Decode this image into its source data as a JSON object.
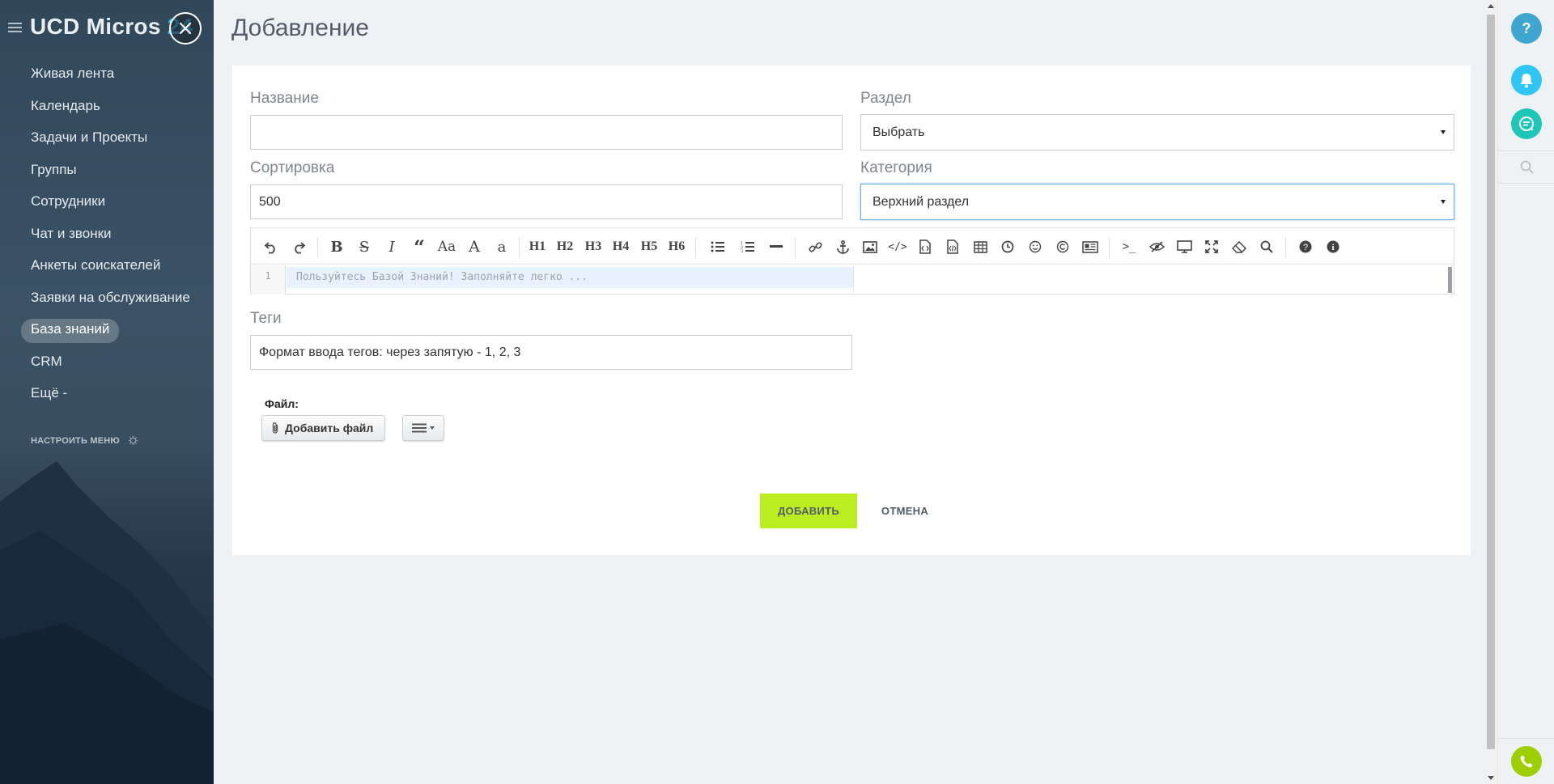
{
  "sidebar": {
    "logo_main": "UCD Micros ",
    "logo_num": "24",
    "items": [
      {
        "label": "Живая лента"
      },
      {
        "label": "Календарь"
      },
      {
        "label": "Задачи и Проекты"
      },
      {
        "label": "Группы"
      },
      {
        "label": "Сотрудники"
      },
      {
        "label": "Чат и звонки"
      },
      {
        "label": "Анкеты соискателей"
      },
      {
        "label": "Заявки на обслуживание"
      },
      {
        "label": "База знаний",
        "active": true
      },
      {
        "label": "CRM"
      }
    ],
    "more_label": "Ещё -",
    "configure_label": "НАСТРОИТЬ МЕНЮ"
  },
  "page": {
    "title": "Добавление"
  },
  "form": {
    "name_label": "Название",
    "name_value": "",
    "section_label": "Раздел",
    "section_value": "Выбрать",
    "sort_label": "Сортировка",
    "sort_value": "500",
    "category_label": "Категория",
    "category_value": "Верхний раздел",
    "editor": {
      "line_number": "1",
      "placeholder": "Пользуйтесь Базой Знаний! Заполняйте легко ...",
      "toolbar": [
        "undo-icon",
        "redo-icon",
        "bold-icon",
        "strikethrough-icon",
        "italic-icon",
        "quote-icon",
        "case-icon",
        "uppercase-icon",
        "lowercase-icon",
        "h1",
        "h2",
        "h3",
        "h4",
        "h5",
        "h6",
        "bullet-list-icon",
        "numbered-list-icon",
        "horizontal-rule-icon",
        "link-icon",
        "anchor-icon",
        "image-icon",
        "code-icon",
        "code-block-icon",
        "code-file-icon",
        "table-icon",
        "datetime-icon",
        "emoji-icon",
        "copyright-icon",
        "html-entities-icon",
        "terminal-icon",
        "preview-icon",
        "watch-icon",
        "fullscreen-icon",
        "clear-icon",
        "search-icon",
        "help-icon",
        "info-icon"
      ],
      "h_labels": [
        "H1",
        "H2",
        "H3",
        "H4",
        "H5",
        "H6"
      ]
    },
    "tags_label": "Теги",
    "tags_placeholder": "Формат ввода тегов: через запятую - 1, 2, 3",
    "file_label": "Файл:",
    "add_file_label": "Добавить файл",
    "submit_label": "ДОБАВИТЬ",
    "cancel_label": "ОТМЕНА"
  },
  "right_panel": {
    "help_label": "?",
    "items": [
      "help-icon",
      "bell-icon",
      "chat-icon",
      "search-icon",
      "phone-icon"
    ]
  },
  "colors": {
    "accent_green": "#bbed21",
    "help_blue": "#3fa6cf",
    "bell_blue": "#2fc6f6",
    "chat_teal": "#1ec6b8",
    "phone_green": "#9dcf00"
  }
}
